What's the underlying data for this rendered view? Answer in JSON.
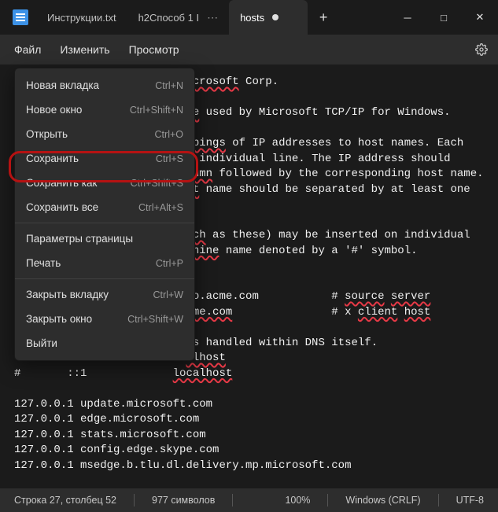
{
  "titlebar": {
    "tabs": [
      {
        "label": "Инструкции.txt"
      },
      {
        "label": "h2Способ 1 I"
      },
      {
        "label": "hosts"
      }
    ]
  },
  "menubar": {
    "items": [
      "Файл",
      "Изменить",
      "Просмотр"
    ]
  },
  "dropdown": {
    "items": [
      {
        "label": "Новая вкладка",
        "shortcut": "Ctrl+N"
      },
      {
        "label": "Новое окно",
        "shortcut": "Ctrl+Shift+N"
      },
      {
        "label": "Открыть",
        "shortcut": "Ctrl+O"
      },
      {
        "label": "Сохранить",
        "shortcut": "Ctrl+S"
      },
      {
        "label": "Сохранить как",
        "shortcut": "Ctrl+Shift+S"
      },
      {
        "label": "Сохранить все",
        "shortcut": "Ctrl+Alt+S"
      },
      {
        "sep": true
      },
      {
        "label": "Параметры страницы",
        "shortcut": ""
      },
      {
        "label": "Печать",
        "shortcut": "Ctrl+P"
      },
      {
        "sep": true
      },
      {
        "label": "Закрыть вкладку",
        "shortcut": "Ctrl+W"
      },
      {
        "label": "Закрыть окно",
        "shortcut": "Ctrl+Shift+W"
      },
      {
        "label": "Выйти",
        "shortcut": ""
      }
    ]
  },
  "editor": {
    "lines": [
      {
        "prefix": "                          ",
        "parts": [
          {
            "t": "icrosoft",
            "u": true
          },
          {
            "t": " Corp."
          }
        ]
      },
      {
        "prefix": "",
        "parts": []
      },
      {
        "prefix": "                          ",
        "parts": [
          {
            "t": "le",
            "u": true
          },
          {
            "t": " used by Microsoft TCP/IP for Windows."
          }
        ]
      },
      {
        "prefix": "",
        "parts": []
      },
      {
        "prefix": "                          ",
        "parts": [
          {
            "t": "ppings",
            "u": true
          },
          {
            "t": " of IP addresses to host names. Each"
          }
        ]
      },
      {
        "prefix": "                          ",
        "parts": [
          {
            "t": "n",
            "u": true
          },
          {
            "t": " individual line. The IP address should"
          }
        ]
      },
      {
        "prefix": "                          ",
        "parts": [
          {
            "t": "lumn",
            "u": true
          },
          {
            "t": " followed by the corresponding host name."
          }
        ]
      },
      {
        "prefix": "                          ",
        "parts": [
          {
            "t": "st",
            "u": true
          },
          {
            "t": " name should be separated by at least one"
          }
        ]
      },
      {
        "prefix": "",
        "parts": []
      },
      {
        "prefix": "",
        "parts": []
      },
      {
        "prefix": "                          ",
        "parts": [
          {
            "t": "uch",
            "u": true
          },
          {
            "t": " as these) may be inserted on individual"
          }
        ]
      },
      {
        "prefix": "                          ",
        "parts": [
          {
            "t": "chine",
            "u": true
          },
          {
            "t": " name denoted by a '#' symbol."
          }
        ]
      },
      {
        "prefix": "",
        "parts": []
      },
      {
        "prefix": "",
        "parts": []
      },
      {
        "prefix": "                          ",
        "parts": [
          {
            "t": "no.acme.com           # ",
            "u": false
          },
          {
            "t": "source",
            "u": true
          },
          {
            "t": " ",
            "u": false
          },
          {
            "t": "server",
            "u": true
          }
        ]
      },
      {
        "prefix": "                          ",
        "parts": [
          {
            "t": "cme.com",
            "u": true
          },
          {
            "t": "               # x ",
            "u": false
          },
          {
            "t": "client",
            "u": true
          },
          {
            "t": " ",
            "u": false
          },
          {
            "t": "host",
            "u": true
          }
        ]
      },
      {
        "prefix": "",
        "parts": []
      },
      {
        "prefix": "                          ",
        "parts": [
          {
            "t": "is handled within DNS itself."
          }
        ]
      },
      {
        "prefix": "                          ",
        "parts": [
          {
            "t": "alhost",
            "u": true
          }
        ]
      },
      {
        "prefix": "#       ::1             ",
        "parts": [
          {
            "t": "localhost",
            "u": true
          }
        ]
      },
      {
        "prefix": "",
        "parts": []
      },
      {
        "prefix": "127.0.0.1 update.microsoft.com",
        "parts": []
      },
      {
        "prefix": "127.0.0.1 edge.microsoft.com",
        "parts": []
      },
      {
        "prefix": "127.0.0.1 stats.microsoft.com",
        "parts": []
      },
      {
        "prefix": "127.0.0.1 config.edge.skype.com",
        "parts": []
      },
      {
        "prefix": "127.0.0.1 msedge.b.tlu.dl.delivery.mp.microsoft.com",
        "parts": []
      }
    ]
  },
  "statusbar": {
    "position": "Строка 27, столбец 52",
    "chars": "977 символов",
    "zoom": "100%",
    "eol": "Windows (CRLF)",
    "encoding": "UTF-8"
  }
}
